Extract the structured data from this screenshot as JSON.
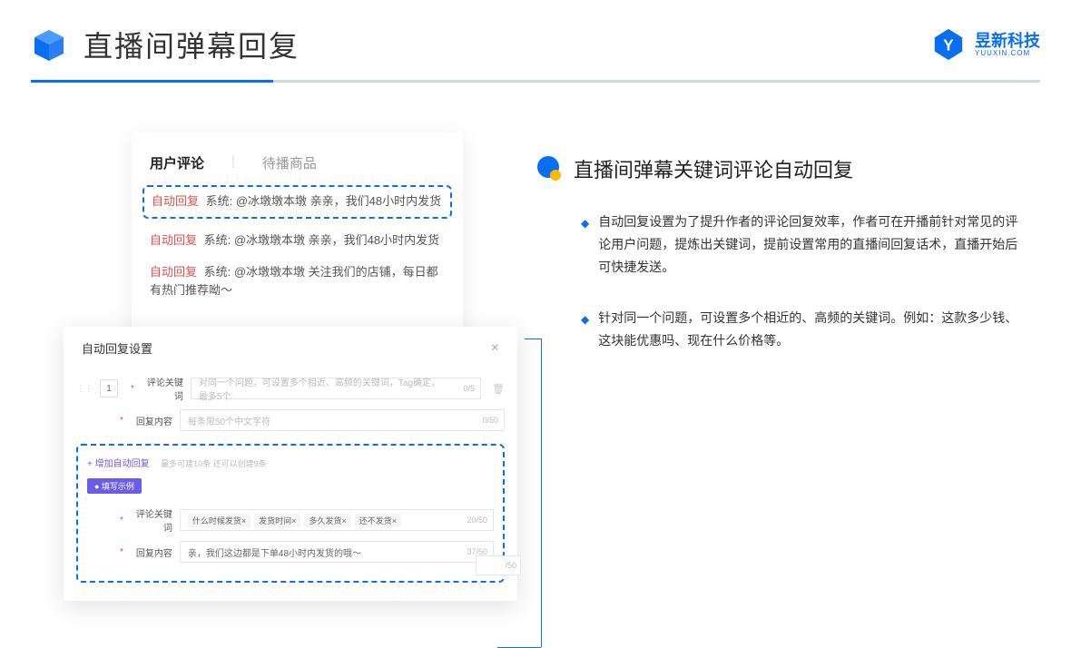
{
  "header": {
    "title": "直播间弹幕回复",
    "brand_cn": "昱新科技",
    "brand_en": "YUUXIN.COM"
  },
  "comments": {
    "tab_active": "用户评论",
    "tab_inactive": "待播商品",
    "auto_tag": "自动回复",
    "items": [
      "系统: @冰墩墩本墩 亲亲，我们48小时内发货",
      "系统: @冰墩墩本墩 亲亲，我们48小时内发货",
      "系统: @冰墩墩本墩 关注我们的店铺，每日都有热门推荐呦～"
    ]
  },
  "settings": {
    "title": "自动回复设置",
    "idx": "1",
    "row1_label": "评论关键词",
    "row1_placeholder": "对同一个问题，可设置多个相近、高频的关键词，Tag确定，最多5个",
    "row1_count": "0/5",
    "row2_label": "回复内容",
    "row2_placeholder": "每条限50个中文字符",
    "row2_count": "0/50",
    "add_text": "+ 增加自动回复",
    "add_hint": "最多可建10条 还可以创建9条",
    "example_badge": "● 填写示例",
    "ex_row1_label": "评论关键词",
    "ex_tags": [
      "什么时候发货×",
      "发货时间×",
      "多久发货×",
      "还不发货×"
    ],
    "ex_row1_count": "20/50",
    "ex_row2_label": "回复内容",
    "ex_row2_value": "亲，我们这边都是下单48小时内发货的哦～",
    "ex_row2_count": "37/50",
    "overflow_count": "/50"
  },
  "right": {
    "section_title": "直播间弹幕关键词评论自动回复",
    "bullets": [
      "自动回复设置为了提升作者的评论回复效率，作者可在开播前针对常见的评论用户问题，提炼出关键词，提前设置常用的直播间回复话术，直播开始后可快捷发送。",
      "针对同一个问题，可设置多个相近的、高频的关键词。例如：这款多少钱、这块能优惠吗、现在什么价格等。"
    ]
  }
}
